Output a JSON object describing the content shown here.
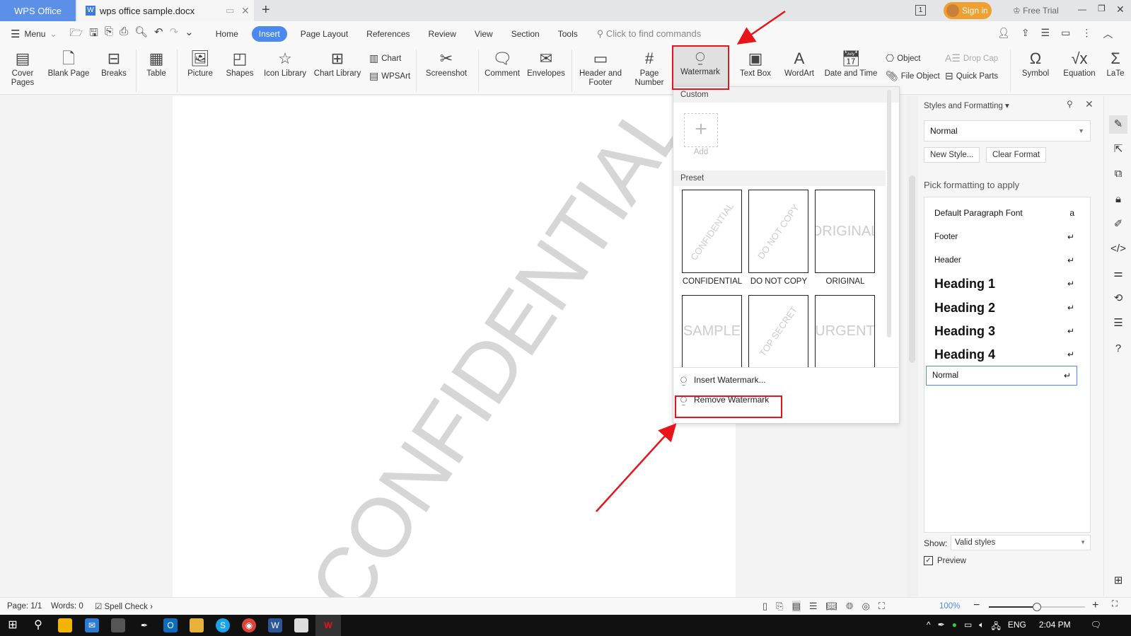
{
  "titlebar": {
    "app_tab": "WPS Office",
    "doc_tab": "wps office sample.docx",
    "new_tab": "+",
    "sign_in": "Sign in",
    "free_trial": "Free Trial",
    "window_counter": "1"
  },
  "menubar": {
    "menu": "Menu",
    "tabs": [
      "Home",
      "Insert",
      "Page Layout",
      "References",
      "Review",
      "View",
      "Section",
      "Tools"
    ],
    "active_tab": "Insert",
    "search_placeholder": "Click to find commands"
  },
  "ribbon": {
    "cover_pages": "Cover Pages",
    "blank_page": "Blank Page",
    "breaks": "Breaks",
    "table": "Table",
    "picture": "Picture",
    "shapes": "Shapes",
    "icon_library": "Icon Library",
    "chart_library": "Chart Library",
    "chart": "Chart",
    "wpsart": "WPSArt",
    "screenshot": "Screenshot",
    "comment": "Comment",
    "envelopes": "Envelopes",
    "header_footer": "Header and Footer",
    "page_number": "Page Number",
    "watermark": "Watermark",
    "text_box": "Text Box",
    "wordart": "WordArt",
    "date_time": "Date and Time",
    "object": "Object",
    "file_object": "File Object",
    "drop_cap": "Drop Cap",
    "quick_parts": "Quick Parts",
    "symbol": "Symbol",
    "equation": "Equation",
    "latex": "LaTe"
  },
  "document": {
    "watermark_text": "CONFIDENTIAL"
  },
  "watermark_menu": {
    "custom_header": "Custom",
    "add_label": "Add",
    "preset_header": "Preset",
    "presets": [
      "CONFIDENTIAL",
      "DO NOT COPY",
      "ORIGINAL",
      "SAMPLE",
      "TOP SECRET",
      "URGENT"
    ],
    "insert": "Insert Watermark...",
    "remove": "Remove Watermark"
  },
  "styles_panel": {
    "title": "Styles and Formatting",
    "current": "Normal",
    "new_style": "New Style...",
    "clear_format": "Clear Format",
    "pick_label": "Pick formatting to apply",
    "styles": [
      "Default Paragraph Font",
      "Footer",
      "Header",
      "Heading 1",
      "Heading 2",
      "Heading 3",
      "Heading 4",
      "Normal"
    ],
    "show_label": "Show:",
    "show_value": "Valid styles",
    "preview_label": "Preview",
    "preview_checked": true
  },
  "statusbar": {
    "page": "Page: 1/1",
    "words": "Words: 0",
    "spell_check": "Spell Check",
    "zoom": "100%",
    "zoom_level": 0.5
  },
  "taskbar": {
    "lang": "ENG",
    "time": "2:04 PM"
  },
  "colors": {
    "accent": "#4a8af0",
    "annotation": "#e8141a",
    "sign_in": "#f0a030"
  }
}
